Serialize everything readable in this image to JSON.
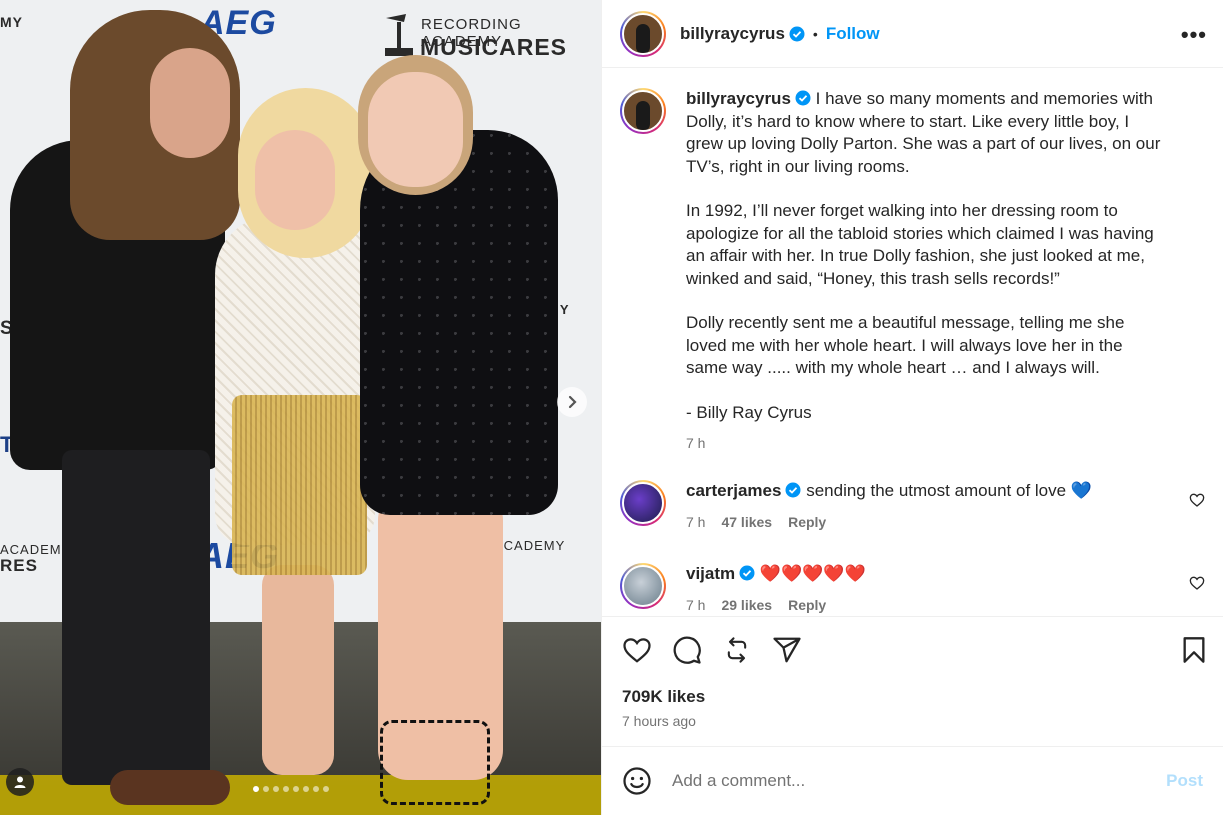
{
  "post": {
    "author": "billyraycyrus",
    "follow_label": "Follow",
    "separator": "•",
    "more_label": "•••",
    "caption": {
      "paragraphs": [
        "I have so many moments and memories with Dolly, it’s hard to know where to start. Like every little boy, I grew up loving Dolly Parton. She was a part of our lives, on our TV’s, right in our living rooms.",
        "In 1992, I’ll never forget walking into her dressing room to apologize for all the tabloid stories which claimed I was having an affair with her. In true Dolly fashion, she just looked at me, winked and said, “Honey, this trash sells records!”",
        "Dolly recently sent me a beautiful message, telling me she loved me with her whole heart. I will always love her in the same way ..... with my whole heart … and I always will.",
        "- Billy Ray Cyrus"
      ],
      "time": "7 h"
    },
    "comments": [
      {
        "user": "carterjames",
        "text": "sending the utmost amount of love 💙",
        "time": "7 h",
        "likes": "47 likes",
        "reply": "Reply",
        "avatar_icon": "user-avatar-icon"
      },
      {
        "user": "vijatm",
        "text": "❤️❤️❤️❤️❤️",
        "time": "7 h",
        "likes": "29 likes",
        "reply": "Reply",
        "avatar_icon": "user-avatar-icon"
      }
    ],
    "likes_count": "709K likes",
    "posted_ago": "7 hours ago",
    "comment_placeholder": "Add a comment...",
    "post_label": "Post"
  },
  "photo": {
    "backdrop_texts": {
      "recording_academy": "RECORDING ACADEMY",
      "musicares": "MUSICARES",
      "aeg": "AEG",
      "my": "MY",
      "academy": "ACADEMY",
      "res": "RES",
      "ta": "TA",
      "ca": "CA",
      "s": "S"
    },
    "carousel_dots": 8,
    "active_dot": 0,
    "next_icon": "chevron-right-icon",
    "tag_icon": "person-icon"
  },
  "icons": {
    "like": "heart-icon",
    "comment": "comment-bubble-icon",
    "share": "repost-icon",
    "send": "send-icon",
    "save": "bookmark-icon",
    "emoji": "emoji-icon",
    "verified": "verified-badge-icon"
  },
  "colors": {
    "link_blue": "#0095f6",
    "verified_blue": "#0095f6",
    "post_disabled": "#b2dffc",
    "muted_text": "#737373"
  }
}
